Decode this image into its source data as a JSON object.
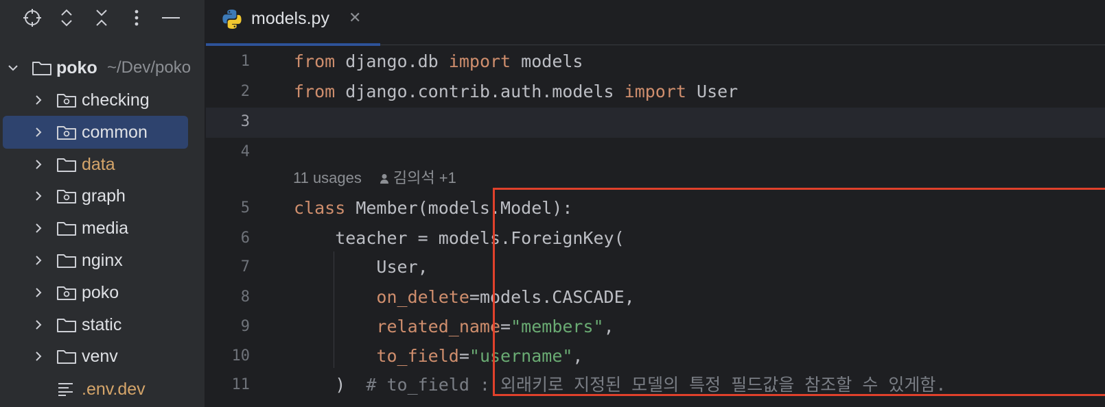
{
  "sidebar": {
    "toolbar": [
      {
        "name": "locate-icon"
      },
      {
        "name": "expand-all-icon"
      },
      {
        "name": "collapse-all-icon"
      },
      {
        "name": "more-options-icon"
      },
      {
        "name": "hide-panel-icon"
      }
    ],
    "root": {
      "label": "poko",
      "path": "~/Dev/poko"
    },
    "items": [
      {
        "label": "checking",
        "type": "package",
        "color": "#dfe1e5"
      },
      {
        "label": "common",
        "type": "package",
        "color": "#dfe1e5",
        "selected": true
      },
      {
        "label": "data",
        "type": "folder",
        "color": "#d5a56a"
      },
      {
        "label": "graph",
        "type": "package",
        "color": "#dfe1e5"
      },
      {
        "label": "media",
        "type": "folder",
        "color": "#dfe1e5"
      },
      {
        "label": "nginx",
        "type": "folder",
        "color": "#dfe1e5"
      },
      {
        "label": "poko",
        "type": "package",
        "color": "#dfe1e5"
      },
      {
        "label": "static",
        "type": "folder",
        "color": "#dfe1e5"
      },
      {
        "label": "venv",
        "type": "folder",
        "color": "#dfe1e5"
      }
    ],
    "file": {
      "label": ".env.dev",
      "color": "#d5a56a"
    }
  },
  "editor": {
    "tab": {
      "label": "models.py",
      "close": "✕"
    },
    "inlay_hint": {
      "usages": "11 usages",
      "authors": "김의석 +1"
    },
    "lines": [
      {
        "num": "1",
        "tokens": [
          [
            "kw",
            "from"
          ],
          [
            "plain",
            " django.db "
          ],
          [
            "kw",
            "import"
          ],
          [
            "plain",
            " models"
          ]
        ]
      },
      {
        "num": "2",
        "tokens": [
          [
            "kw",
            "from"
          ],
          [
            "plain",
            " django.contrib.auth.models "
          ],
          [
            "kw",
            "import"
          ],
          [
            "plain",
            " User"
          ]
        ]
      },
      {
        "num": "3",
        "tokens": []
      },
      {
        "num": "4",
        "tokens": []
      },
      {
        "num": "5",
        "tokens": [
          [
            "kw",
            "class"
          ],
          [
            "plain",
            " Member(models.Model):"
          ]
        ]
      },
      {
        "num": "6",
        "tokens": [
          [
            "plain",
            "    teacher = models.ForeignKey("
          ]
        ]
      },
      {
        "num": "7",
        "tokens": [
          [
            "plain",
            "        User,"
          ]
        ]
      },
      {
        "num": "8",
        "tokens": [
          [
            "plain",
            "        "
          ],
          [
            "param",
            "on_delete"
          ],
          [
            "plain",
            "=models.CASCADE,"
          ]
        ]
      },
      {
        "num": "9",
        "tokens": [
          [
            "plain",
            "        "
          ],
          [
            "param",
            "related_name"
          ],
          [
            "plain",
            "="
          ],
          [
            "str",
            "\"members\""
          ],
          [
            "plain",
            ","
          ]
        ]
      },
      {
        "num": "10",
        "tokens": [
          [
            "plain",
            "        "
          ],
          [
            "param",
            "to_field"
          ],
          [
            "plain",
            "="
          ],
          [
            "str",
            "\"username\""
          ],
          [
            "plain",
            ","
          ]
        ]
      },
      {
        "num": "11",
        "tokens": [
          [
            "plain",
            "    )  "
          ],
          [
            "cm",
            "# to_field : 외래키로 지정된 모델의 특정 필드값을 참조할 수 있게함."
          ]
        ]
      }
    ],
    "current_line": "3"
  },
  "colors": {
    "background": "#1e1f22",
    "sidebar": "#2b2d30",
    "selection": "#2e436e",
    "keyword": "#cf8e6d",
    "string": "#6aab73",
    "comment": "#7a7e85",
    "highlight_box": "#e0412b"
  }
}
